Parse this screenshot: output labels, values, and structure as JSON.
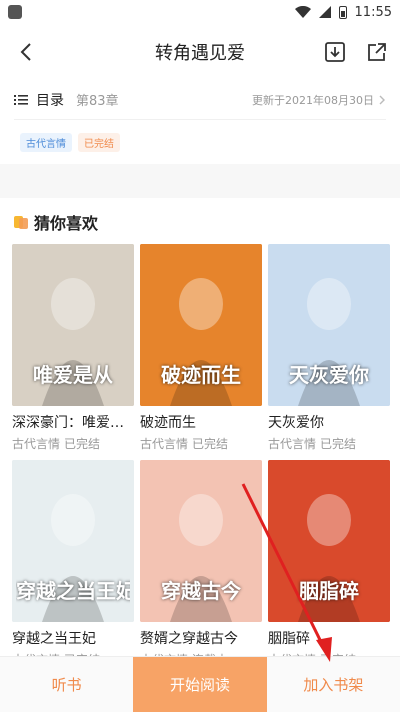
{
  "status_bar": {
    "time": "11:55"
  },
  "header": {
    "title": "转角遇见爱"
  },
  "toc": {
    "label": "目录",
    "chapter": "第83章",
    "updated": "更新于2021年08月30日"
  },
  "tags": [
    "古代言情",
    "已完结"
  ],
  "recommend": {
    "title": "猜你喜欢",
    "books": [
      {
        "name": "深深豪门：唯爱是从",
        "category": "古代言情",
        "status": "已完结",
        "cover_text": "唯爱是从",
        "cover_color": "#d8d0c4"
      },
      {
        "name": "破迹而生",
        "category": "古代言情",
        "status": "已完结",
        "cover_text": "破迹而生",
        "cover_color": "#e6842c"
      },
      {
        "name": "天灰爱你",
        "category": "古代言情",
        "status": "已完结",
        "cover_text": "天灰爱你",
        "cover_color": "#c9dcef"
      },
      {
        "name": "穿越之当王妃",
        "category": "古代言情",
        "status": "已完结",
        "cover_text": "穿越之当王妃",
        "cover_color": "#e7eef0"
      },
      {
        "name": "赘婿之穿越古今",
        "category": "古代言情",
        "status": "连载中",
        "cover_text": "穿越古今",
        "cover_color": "#f3c3b3"
      },
      {
        "name": "胭脂碎",
        "category": "古代言情",
        "status": "已完结",
        "cover_text": "胭脂碎",
        "cover_color": "#d94a2c"
      }
    ]
  },
  "bottom_bar": {
    "listen": "听书",
    "read": "开始阅读",
    "add_shelf": "加入书架"
  },
  "colors": {
    "accent": "#f08a4b",
    "primary_button": "#f7a366",
    "arrow": "#e02020"
  }
}
